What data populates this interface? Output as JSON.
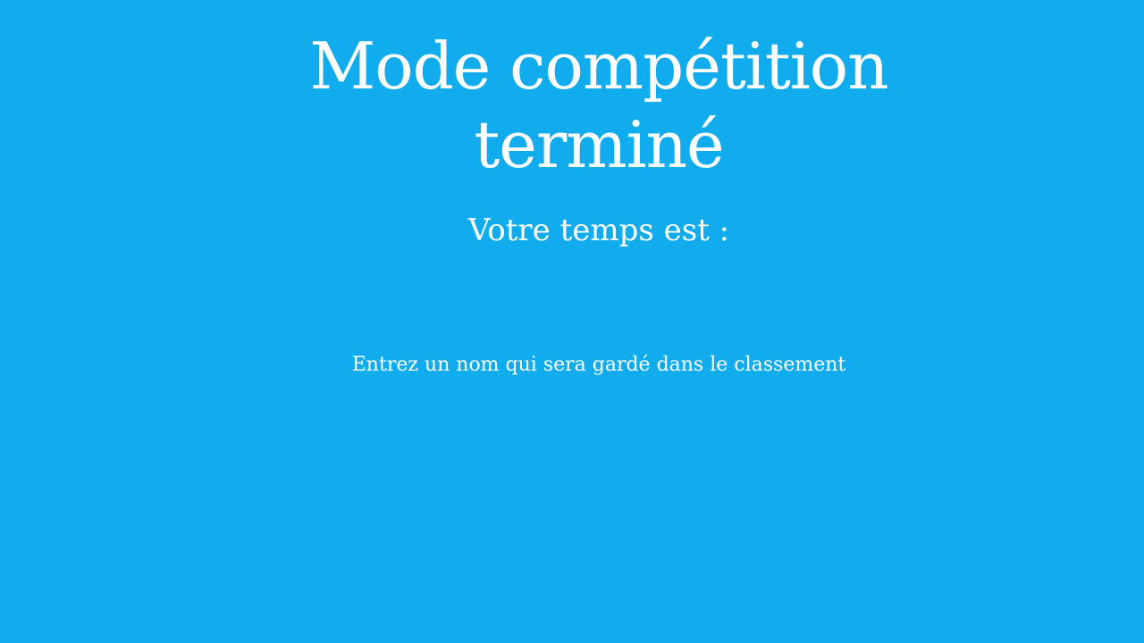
{
  "screen": {
    "title": "Mode compétition terminé",
    "time_label": "Votre temps est :",
    "time_value": "",
    "name_prompt": "Entrez un nom qui sera gardé dans le classement",
    "name_input_value": "",
    "name_input_placeholder": ""
  },
  "colors": {
    "background": "#10acee",
    "text": "#ffffff"
  }
}
